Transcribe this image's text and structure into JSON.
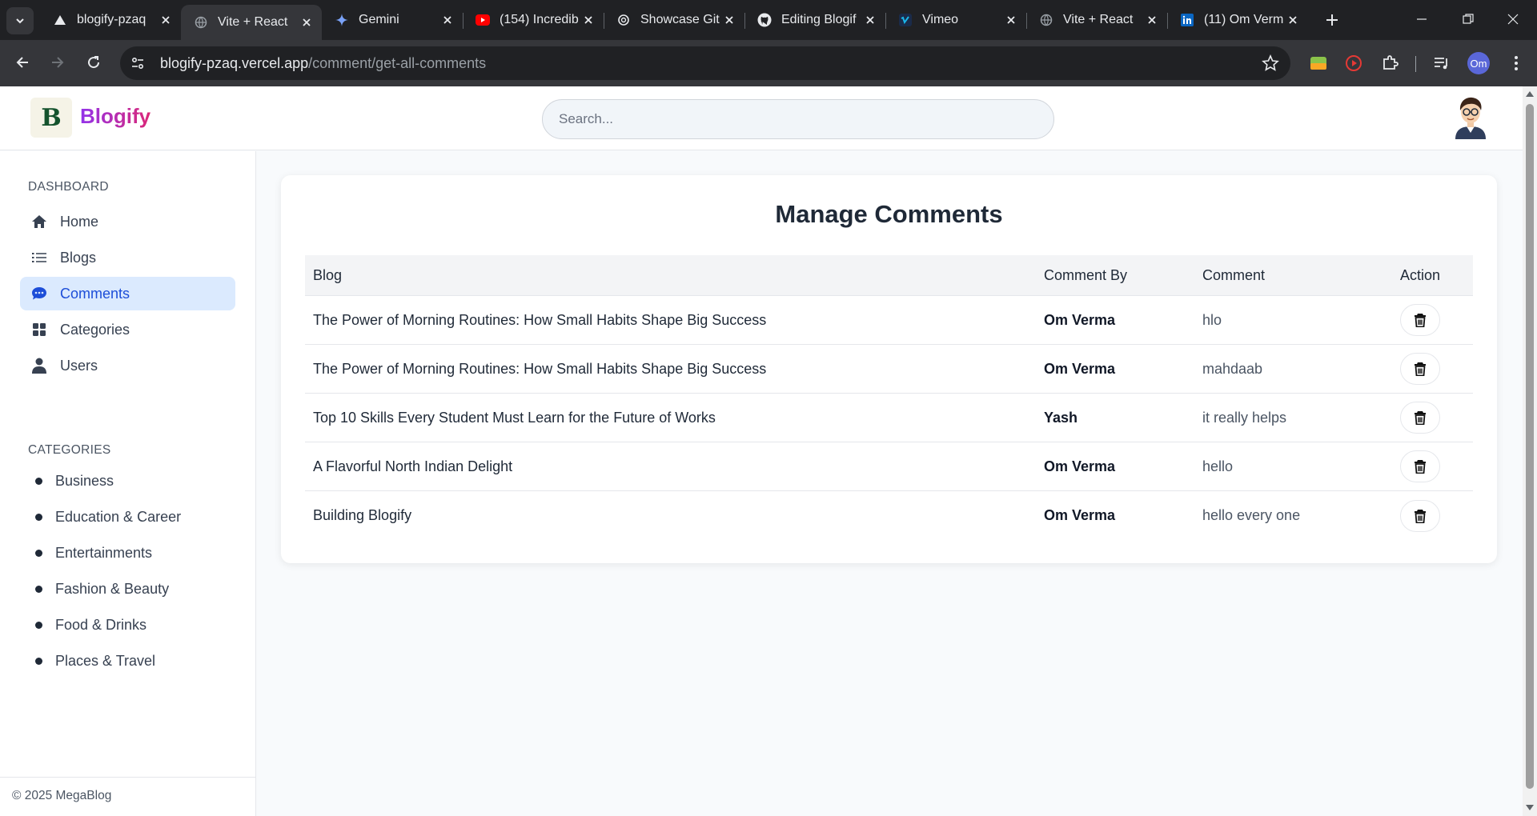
{
  "browser": {
    "tabs": [
      {
        "title": "blogify-pzaq",
        "favicon": "vercel-icon"
      },
      {
        "title": "Vite + React",
        "favicon": "globe-icon",
        "active": true
      },
      {
        "title": "Gemini",
        "favicon": "gemini-icon"
      },
      {
        "title": "(154) Incredib",
        "favicon": "youtube-icon"
      },
      {
        "title": "Showcase Git",
        "favicon": "openai-icon"
      },
      {
        "title": "Editing Blogif",
        "favicon": "github-icon"
      },
      {
        "title": "Vimeo",
        "favicon": "vimeo-icon"
      },
      {
        "title": "Vite + React",
        "favicon": "globe-icon"
      },
      {
        "title": "(11) Om Verm",
        "favicon": "linkedin-icon"
      }
    ],
    "url_host": "blogify-pzaq.vercel.app",
    "url_path": "/comment/get-all-comments",
    "profile_initials": "Om"
  },
  "header": {
    "logo_letter": "B",
    "brand": "Blogify",
    "search_placeholder": "Search..."
  },
  "sidebar": {
    "dashboard_heading": "DASHBOARD",
    "items": [
      {
        "label": "Home",
        "icon": "home-icon"
      },
      {
        "label": "Blogs",
        "icon": "list-icon"
      },
      {
        "label": "Comments",
        "icon": "comments-icon",
        "active": true
      },
      {
        "label": "Categories",
        "icon": "grid-icon"
      },
      {
        "label": "Users",
        "icon": "user-icon"
      }
    ],
    "categories_heading": "CATEGORIES",
    "categories": [
      "Business",
      "Education & Career",
      "Entertainments",
      "Fashion & Beauty",
      "Food & Drinks",
      "Places & Travel"
    ],
    "footer": "© 2025 MegaBlog"
  },
  "main": {
    "title": "Manage Comments",
    "columns": {
      "blog": "Blog",
      "by": "Comment By",
      "comment": "Comment",
      "action": "Action"
    },
    "rows": [
      {
        "blog": "The Power of Morning Routines: How Small Habits Shape Big Success",
        "by": "Om Verma",
        "comment": "hlo"
      },
      {
        "blog": "The Power of Morning Routines: How Small Habits Shape Big Success",
        "by": "Om Verma",
        "comment": "mahdaab"
      },
      {
        "blog": "Top 10 Skills Every Student Must Learn for the Future of Works",
        "by": "Yash",
        "comment": "it really helps"
      },
      {
        "blog": "A Flavorful North Indian Delight",
        "by": "Om Verma",
        "comment": "hello"
      },
      {
        "blog": "Building Blogify",
        "by": "Om Verma",
        "comment": "hello every one"
      }
    ]
  },
  "colors": {
    "accent": "#1d4ed8",
    "active_bg": "#dbeafe",
    "brand_gradient_start": "#9333ea",
    "brand_gradient_end": "#db2777"
  }
}
